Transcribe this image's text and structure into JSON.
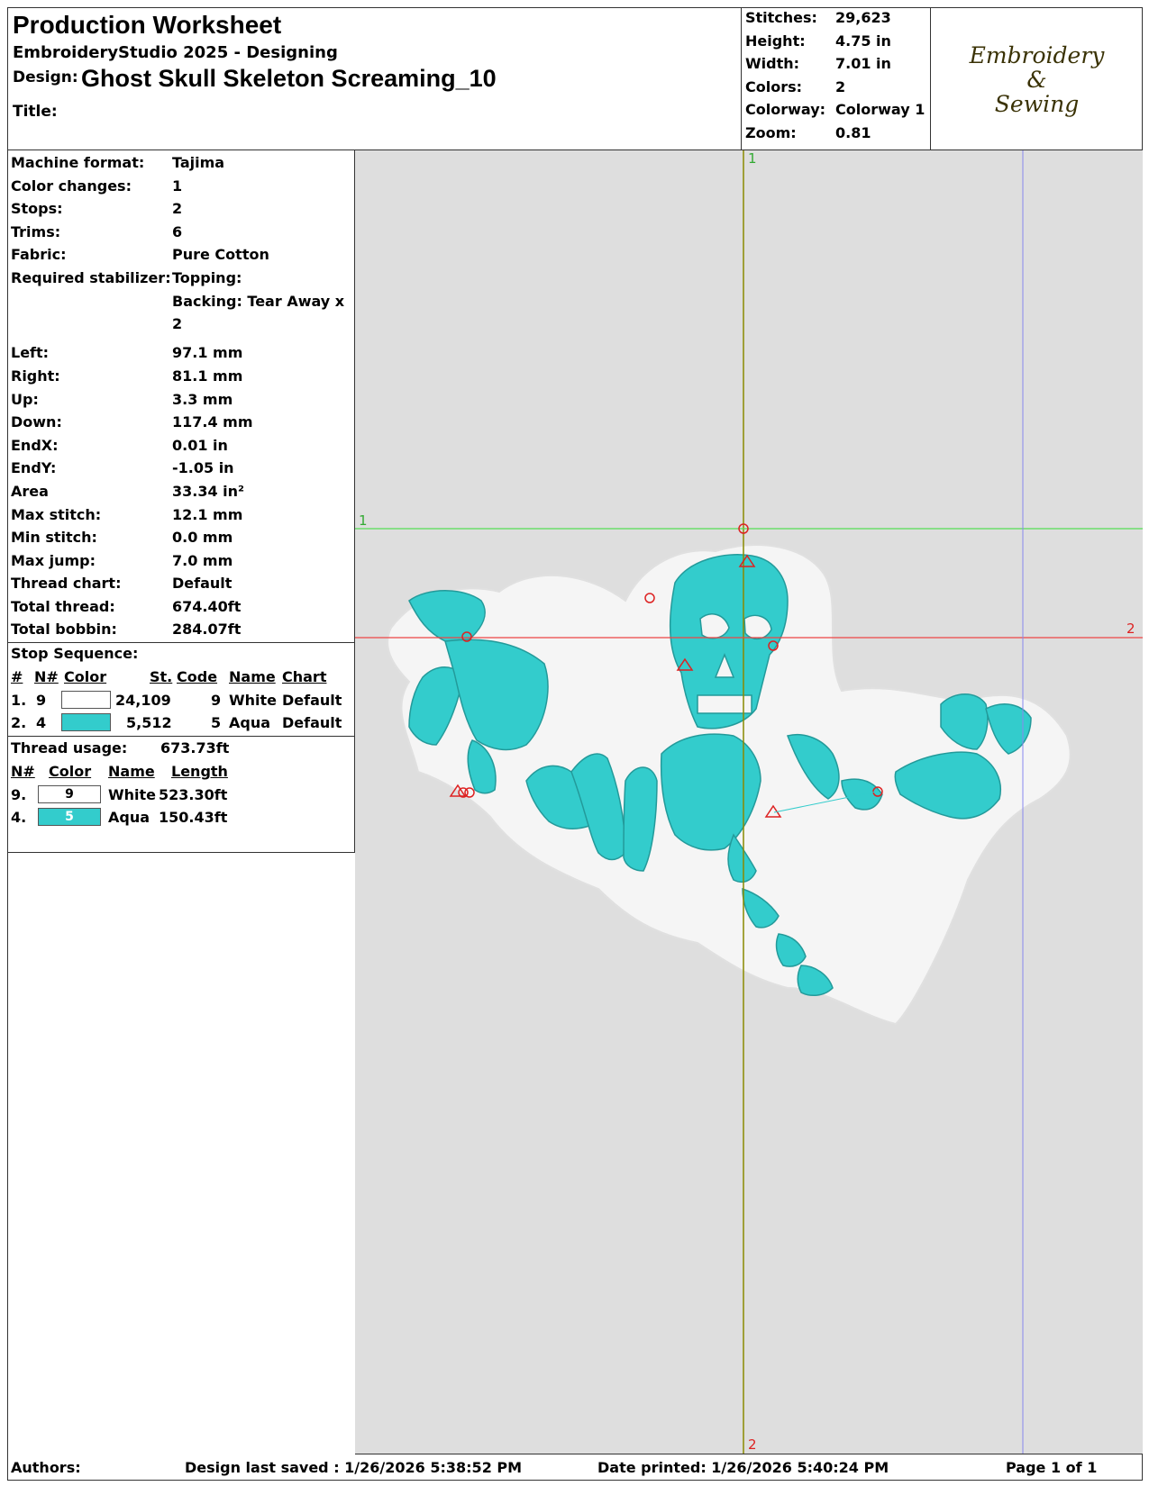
{
  "header": {
    "title": "Production Worksheet",
    "app": "EmbroideryStudio 2025 - Designing",
    "design_label": "Design:",
    "design_name": "Ghost Skull Skeleton Screaming_10",
    "title_label": "Title:"
  },
  "stats": [
    {
      "label": "Stitches:",
      "value": "29,623"
    },
    {
      "label": "Height:",
      "value": "4.75 in"
    },
    {
      "label": "Width:",
      "value": "7.01 in"
    },
    {
      "label": "Colors:",
      "value": "2"
    },
    {
      "label": "Colorway:",
      "value": "Colorway 1"
    },
    {
      "label": "Zoom:",
      "value": "0.81"
    }
  ],
  "logo": {
    "text": "Embroidery\n&\nSewing",
    "color": "#3a3205"
  },
  "info": [
    {
      "label": "Machine format:",
      "value": "Tajima"
    },
    {
      "label": "Color changes:",
      "value": "1"
    },
    {
      "label": "Stops:",
      "value": "2"
    },
    {
      "label": "Trims:",
      "value": "6"
    },
    {
      "label": "Fabric:",
      "value": "Pure Cotton"
    },
    {
      "label": "Required stabilizer:",
      "value": "Topping:"
    },
    {
      "label": "",
      "value": "Backing: Tear Away x"
    },
    {
      "label": "",
      "value": "2"
    },
    {
      "label": "Left:",
      "value": "97.1 mm"
    },
    {
      "label": "Right:",
      "value": "81.1 mm"
    },
    {
      "label": "Up:",
      "value": "3.3 mm"
    },
    {
      "label": "Down:",
      "value": "117.4 mm"
    },
    {
      "label": "EndX:",
      "value": "0.01 in"
    },
    {
      "label": "EndY:",
      "value": "-1.05 in"
    },
    {
      "label": "Area",
      "value": " 33.34 in²"
    },
    {
      "label": "Max stitch:",
      "value": "12.1 mm"
    },
    {
      "label": "Min stitch:",
      "value": "0.0 mm"
    },
    {
      "label": "Max jump:",
      "value": "7.0 mm"
    },
    {
      "label": "Thread chart:",
      "value": "Default"
    },
    {
      "label": "Total thread:",
      "value": "674.40ft"
    },
    {
      "label": "Total bobbin:",
      "value": "284.07ft"
    }
  ],
  "stop_sequence": {
    "title": "Stop Sequence:",
    "headers": [
      "#",
      "N#",
      "Color",
      "St.",
      "Code",
      "Name",
      "Chart"
    ],
    "rows": [
      {
        "num": "1.",
        "n": "9",
        "color": "#ffffff",
        "stitches": "24,109",
        "code": "9",
        "name": "White",
        "chart": "Default"
      },
      {
        "num": "2.",
        "n": "4",
        "color": "#33cccc",
        "stitches": "5,512",
        "code": "5",
        "name": "Aqua",
        "chart": "Default"
      }
    ]
  },
  "thread_usage": {
    "title": "Thread usage:",
    "total": "673.73ft",
    "headers": [
      "N#",
      "Color",
      "Name",
      "Length"
    ],
    "rows": [
      {
        "n": "9.",
        "swatch_code": "9",
        "color": "#ffffff",
        "name": "White",
        "length": "523.30ft"
      },
      {
        "n": "4.",
        "swatch_code": "5",
        "color": "#33cccc",
        "name": "Aqua",
        "length": "150.43ft"
      }
    ]
  },
  "canvas": {
    "background": "#dedede",
    "guide_labels": {
      "v_top": "1",
      "v_bottom": "2",
      "h_left": "1",
      "h_right": "2"
    },
    "guide_colors": {
      "vertical": "#8a8a00",
      "horizontal_1": "#55dd55",
      "horizontal_2": "#ee4444",
      "right": "#8888ee"
    },
    "thread_colors": {
      "white": "#f5f5f5",
      "aqua": "#33cccc"
    }
  },
  "footer": {
    "authors": "Authors:",
    "saved": "Design last saved : 1/26/2026 5:38:52 PM",
    "printed": "Date printed: 1/26/2026 5:40:24 PM",
    "page": "Page 1 of 1"
  }
}
